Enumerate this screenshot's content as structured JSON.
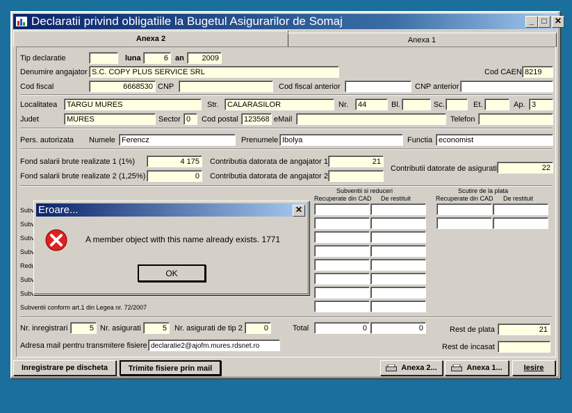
{
  "window": {
    "title": "Declaratii privind obligatiile la Bugetul Asigurarilor de Somaj"
  },
  "controls": {
    "minimize": "_",
    "maximize": "□",
    "close": "✕"
  },
  "tabs": [
    {
      "label": "Anexa 2"
    },
    {
      "label": "Anexa 1"
    }
  ],
  "header": {
    "tip_declaratie_label": "Tip declaratie",
    "tip_declaratie": "",
    "luna_label": "luna",
    "luna": "6",
    "an_label": "an",
    "an": "2009",
    "denumire_label": "Denumire angajator",
    "denumire": "S.C. COPY PLUS SERVICE SRL",
    "cod_caen_label": "Cod CAEN",
    "cod_caen": "8219",
    "cod_fiscal_label": "Cod fiscal",
    "cod_fiscal": "6668530",
    "cnp_label": "CNP",
    "cnp": "",
    "cod_fiscal_anterior_label": "Cod fiscal anterior",
    "cod_fiscal_anterior": "",
    "cnp_anterior_label": "CNP anterior",
    "cnp_anterior": ""
  },
  "address": {
    "localitatea_label": "Localitatea",
    "localitatea": "TARGU MURES",
    "str_label": "Str.",
    "str": "CALARASILOR",
    "nr_label": "Nr.",
    "nr": "44",
    "bl_label": "Bl.",
    "bl": "",
    "sc_label": "Sc.",
    "sc": "",
    "et_label": "Et.",
    "et": "",
    "ap_label": "Ap.",
    "ap": "3",
    "judet_label": "Judet",
    "judet": "MURES",
    "sector_label": "Sector",
    "sector": "0",
    "cod_postal_label": "Cod postal",
    "cod_postal": "123568",
    "email_label": "eMail",
    "email": "",
    "telefon_label": "Telefon",
    "telefon": ""
  },
  "person": {
    "label": "Pers. autorizata",
    "numele_label": "Numele",
    "numele": "Ferencz",
    "prenumele_label": "Prenumele",
    "prenumele": "Ibolya",
    "functia_label": "Functia",
    "functia": "economist"
  },
  "fond": {
    "fond1_label": "Fond salarii brute realizate 1 (1%)",
    "fond1": "4 175",
    "fond2_label": "Fond salarii brute realizate 2 (1,25%)",
    "fond2": "0",
    "contrib1_label": "Contributia datorata de angajator 1",
    "contrib1": "21",
    "contrib2_label": "Contributia datorata de angajator 2",
    "contrib2": "",
    "contrib_asig_label": "Contributii datorate de asigurati",
    "contrib_asig": "22"
  },
  "subventii": {
    "group_label": "Subventii si reduceri",
    "col1": "Recuperate din CAD",
    "col2": "De restituit",
    "row_labels": [
      "Subv",
      "Subv",
      "Subv",
      "Subv",
      "Redu",
      "Subv",
      "Subv",
      "Subventii  conform art.1 din Legea nr. 72/2007"
    ],
    "scutire_label": "Scutire de la plata",
    "scutire_col1": "Recuperate din CAD",
    "scutire_col2": "De restituit"
  },
  "totals": {
    "nr_inreg_label": "Nr. inregistrari",
    "nr_inreg": "5",
    "nr_asig_label": "Nr. asigurati",
    "nr_asig": "5",
    "nr_asig2_label": "Nr. asigurati de tip 2",
    "nr_asig2": "0",
    "total_label": "Total",
    "total1": "0",
    "total2": "0",
    "rest_plata_label": "Rest de plata",
    "rest_plata": "21",
    "rest_incasat_label": "Rest de incasat",
    "rest_incasat": "",
    "adresa_mail_label": "Adresa mail pentru transmitere fisiere",
    "adresa_mail": "declaratie2@ajofm.mures.rdsnet.ro"
  },
  "buttons": {
    "inregistrare": "Inregistrare pe discheta",
    "trimite": "Trimite fisiere prin mail",
    "anexa2": "Anexa 2...",
    "anexa1": "Anexa 1...",
    "iesire": "Iesire"
  },
  "dialog": {
    "title": "Eroare...",
    "close": "✕",
    "message": "A member object with this name already exists. 1771",
    "ok": "OK"
  },
  "colors": {
    "titlebar": "#0a246a",
    "desktop": "#1a6f9c",
    "field": "#ffffe1",
    "error": "#e02020"
  }
}
